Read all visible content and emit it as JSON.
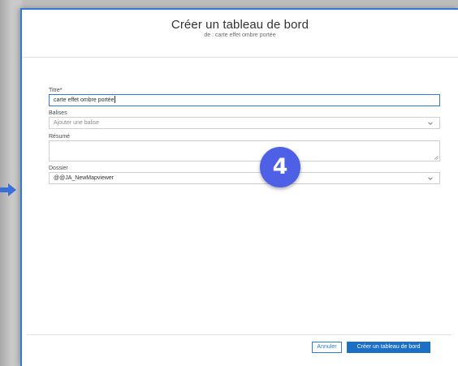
{
  "dialog": {
    "title": "Créer un tableau de bord",
    "subtitle": "de : carte effet ombre portée"
  },
  "form": {
    "title_label": "Titre*",
    "title_value": "carte effet ombre portée",
    "tags_label": "Balises",
    "tags_placeholder": "Ajouter une balise",
    "summary_label": "Résumé",
    "summary_value": "",
    "folder_label": "Dossier",
    "folder_value": "@@JA_NewMapviewer"
  },
  "footer": {
    "cancel_label": "Annuler",
    "create_label": "Créer un tableau de bord"
  },
  "annotation": {
    "step_number": "4",
    "badge_color": "#4e60e6"
  },
  "colors": {
    "accent": "#2f7bd3",
    "primary_button": "#1c6fc6"
  },
  "icons": {
    "dropdown": "chevron-down-icon",
    "pointer": "arrow-right-icon",
    "resize": "resize-handle-icon"
  }
}
